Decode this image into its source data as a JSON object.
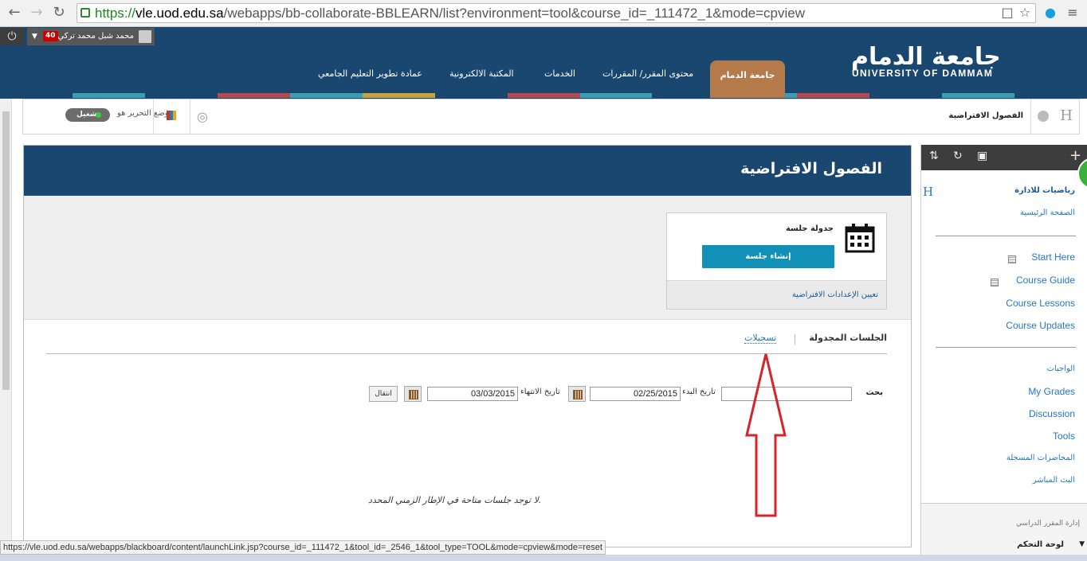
{
  "browser": {
    "url_scheme": "https://",
    "url_host": "vle.uod.edu.sa",
    "url_path": "/webapps/bb-collaborate-BBLEARN/list?environment=tool&course_id=_111472_1&mode=cpview",
    "status_url": "https://vle.uod.edu.sa/webapps/blackboard/content/launchLink.jsp?course_id=_111472_1&tool_id=_2546_1&tool_type=TOOL&mode=cpview&mode=reset",
    "icons": [
      "back-icon",
      "forward-icon",
      "reload-icon",
      "lock-icon",
      "translate-icon",
      "star-icon",
      "skype-icon",
      "menu-icon"
    ]
  },
  "user": {
    "name": "محمد شبل محمد تركي",
    "notifications": "40"
  },
  "logo": {
    "arabic": "جامعة الدمام",
    "english": "UNIVERSITY OF DAMMAM"
  },
  "nav": {
    "active_tab": "جامعة الدمام",
    "tabs": [
      "محتوى المقرر/ المقررات",
      "الخدمات",
      "المكتبة الالكترونية",
      "عمادة تطوير التعليم الجامعي"
    ]
  },
  "breadcrumb": {
    "label": "الفصول الافتراضية",
    "edit_mode_label": "وضع التحرير هو:",
    "edit_mode_state": "تشغيل"
  },
  "main": {
    "title": "الفصول الافتراضية",
    "schedule_title": "جدولة جلسة",
    "create_button": "إنشاء جلسة",
    "default_settings_link": "تعيين الإعدادات الافتراضية",
    "tab_scheduled": "الجلسات المجدولة",
    "tab_recordings": "تسجيلات",
    "search_label": "بحث",
    "start_date_label": "تاريخ البدء",
    "start_date_value": "02/25/2015",
    "end_date_label": "تاريخ الانتهاء",
    "end_date_value": "03/03/2015",
    "go_button": "انتقال",
    "empty_message": "لا توجد جلسات متاحة في الإطار الزمني المحدد."
  },
  "sidebar": {
    "course_name": "رياضيات للادارة",
    "home_link": "الصفحة الرئيسية",
    "links_group1": [
      "Start Here",
      "Course Guide",
      "Course Lessons",
      "Course Updates"
    ],
    "links_group2": [
      "الواجبات",
      "My Grades",
      "Discussion",
      "Tools",
      "المحاضرات المسجلة",
      "البث المباشر"
    ],
    "management_label": "إدارة المقرر الدراسي",
    "control_panel": "لوحة التحكم"
  },
  "colors": {
    "header_blue": "#1a4770",
    "active_tab": "#b47a4a",
    "create_button": "#1190b8",
    "annotation_arrow": "#d8232a"
  }
}
